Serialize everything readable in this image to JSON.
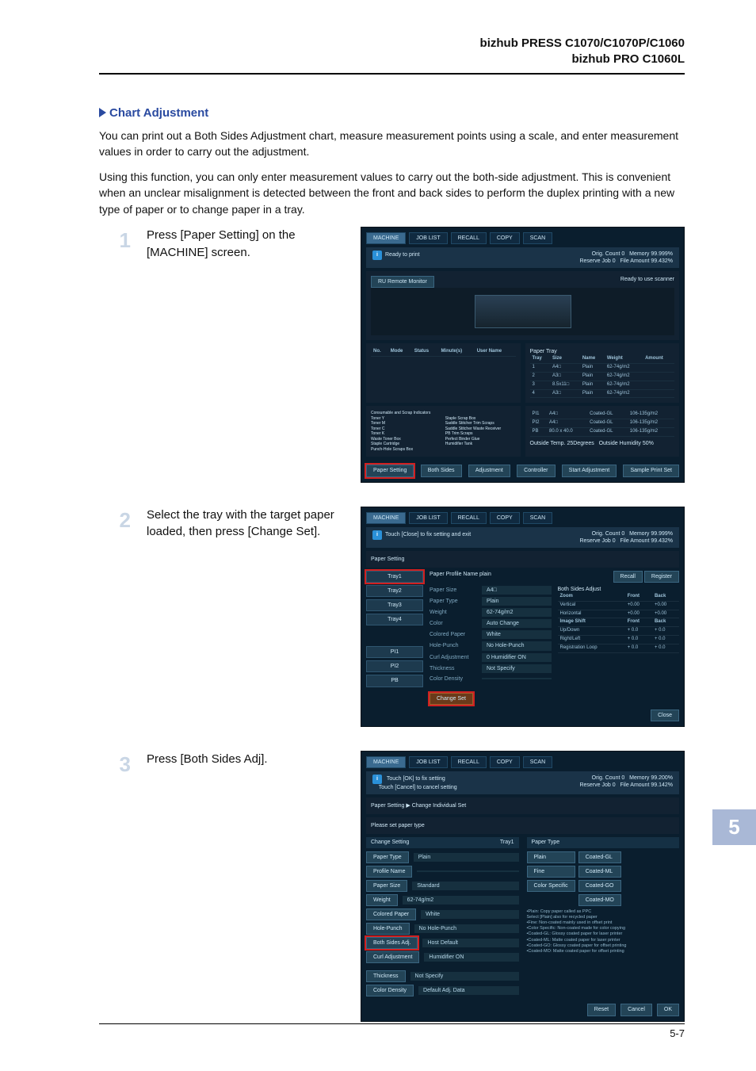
{
  "header": {
    "line1": "bizhub PRESS C1070/C1070P/C1060",
    "line2": "bizhub PRO C1060L"
  },
  "section_title": "Chart Adjustment",
  "paragraphs": {
    "p1": "You can print out a Both Sides Adjustment chart, measure measurement points using a scale, and enter measurement values in order to carry out the adjustment.",
    "p2": "Using this function, you can only enter measurement values to carry out the both-side adjustment. This is convenient when an unclear misalignment is detected between the front and back sides to perform the duplex printing with a new type of paper or to change paper in a tray."
  },
  "steps": {
    "s1": {
      "num": "1",
      "text": "Press [Paper Setting] on the [MACHINE] screen."
    },
    "s2": {
      "num": "2",
      "text": "Select the tray with the target paper loaded, then press [Change Set]."
    },
    "s3": {
      "num": "3",
      "text": "Press [Both Sides Adj]."
    }
  },
  "ss_common": {
    "machine_tab": "MACHINE",
    "joblist_tab": "JOB LIST",
    "recall_tab": "RECALL",
    "copy_tab": "COPY",
    "scan_tab": "SCAN",
    "orig_count": "Orig. Count",
    "reserve": "Reserve Job",
    "memory": "Memory",
    "file": "File Amount",
    "zero": "0",
    "m_pct": "99.999%",
    "f_pct": "99.432%",
    "ready_scanner": "Ready to use scanner"
  },
  "ss1": {
    "status": "Ready to print",
    "remote": "RU Remote Monitor",
    "paper_tray_hdr": "Paper Tray",
    "btn_paper_setting": "Paper Setting",
    "btn_both_sides": "Both Sides",
    "btn_adjustment": "Adjustment",
    "btn_controller": "Controller",
    "btn_start_adj": "Start Adjustment",
    "btn_sample": "Sample Print Set",
    "outside_temp": "Outside Temp.",
    "outside_temp_v": "25Degrees",
    "humidity": "Outside Humidity",
    "humidity_v": "50%",
    "consumable_hdr": "Consumable and Scrap Indicators",
    "trays": {
      "cols": [
        "Tray",
        "Size",
        "Name",
        "Weight",
        "Amount"
      ],
      "rows": [
        [
          "1",
          "A4□",
          "Plain",
          "62-74g/m2",
          ""
        ],
        [
          "2",
          "A3□",
          "Plain",
          "62-74g/m2",
          ""
        ],
        [
          "3",
          "8.5x11□",
          "Plain",
          "62-74g/m2",
          ""
        ],
        [
          "4",
          "A3□",
          "Plain",
          "62-74g/m2",
          ""
        ]
      ]
    },
    "pi_rows": [
      [
        "PI1",
        "A4□",
        "Coated-GL",
        "106-135g/m2"
      ],
      [
        "PI2",
        "A4□",
        "Coated-GL",
        "106-135g/m2"
      ],
      [
        "PB",
        "80.0 x 40.0",
        "Coated-GL",
        "106-135g/m2"
      ]
    ],
    "consumables": [
      "Toner Y",
      "Toner M",
      "Toner C",
      "Toner K",
      "Waste Toner Box",
      "Staple Cartridge",
      "Punch-Hole Scraps Box",
      "Staple Scrap Box",
      "Saddle Stitcher Trim Scraps",
      "Saddle Stitcher Waste Receiver",
      "PB Trim Scraps",
      "Perfect Binder Glue",
      "Humidifier Tank"
    ]
  },
  "ss2": {
    "status": "Touch [Close] to fix setting and exit",
    "breadcrumb": "Paper Setting",
    "tray_lbls": [
      "Tray1",
      "Tray2",
      "Tray3",
      "Tray4"
    ],
    "pi_lbls": [
      "PI1",
      "PI2",
      "PB"
    ],
    "btn_change": "Change Set",
    "btn_close": "Close",
    "btn_recall": "Recall",
    "btn_register": "Register",
    "profile": "Paper Profile Name",
    "profile_v": "plain",
    "both_sides_hdr": "Both Sides Adjust",
    "front": "Front",
    "back": "Back",
    "fields": [
      [
        "Paper Size",
        "A4□"
      ],
      [
        "Paper Type",
        "Plain"
      ],
      [
        "Weight",
        "62-74g/m2"
      ],
      [
        "Color",
        "Auto Change"
      ],
      [
        "Colored Paper",
        "White"
      ],
      [
        "Hole-Punch",
        "No Hole-Punch"
      ],
      [
        "Curl Adjustment",
        "0  Humidifier ON"
      ],
      [
        "Thickness",
        "Not Specify"
      ],
      [
        "Color Density",
        ""
      ]
    ],
    "bs_table": [
      [
        "Zoom",
        "Front",
        "Back"
      ],
      [
        "Vertical",
        "+0.00",
        "+0.00"
      ],
      [
        "Horizontal",
        "+0.00",
        "+0.00"
      ],
      [
        "Image Shift",
        "Front",
        "Back"
      ],
      [
        "Up/Down",
        "+ 0.0",
        "+ 0.0"
      ],
      [
        "Right/Left",
        "+ 0.0",
        "+ 0.0"
      ],
      [
        "Registration Loop",
        "+ 0.0",
        "+ 0.0"
      ]
    ]
  },
  "ss3": {
    "status1": "Touch [OK] to fix setting",
    "status2": "Touch [Cancel] to cancel setting",
    "breadcrumb": "Paper Setting    ▶  Change Individual Set",
    "instr": "Please set paper type",
    "change_hdr": "Change Setting",
    "paper_type_hdr": "Paper Type",
    "col_cat": "Tray1",
    "left_items": [
      [
        "Paper Type",
        "Plain"
      ],
      [
        "Profile Name",
        ""
      ],
      [
        "Paper Size",
        "Standard"
      ],
      [
        "Weight",
        "62-74g/m2"
      ],
      [
        "Colored Paper",
        "White"
      ],
      [
        "Hole-Punch",
        "No Hole-Punch"
      ],
      [
        "Both Sides Adj.",
        "Host Default"
      ],
      [
        "Curl Adjustment",
        "Humidifier ON"
      ]
    ],
    "thickness_row": [
      "Thickness",
      "Not Specify"
    ],
    "density_row": [
      "Color Density",
      "Default Adj. Data"
    ],
    "type_btns": [
      "Plain",
      "Fine",
      "Color Specific"
    ],
    "coat_btns": [
      "Coated-GL",
      "Coated-ML",
      "Coated-GO",
      "Coated-MO"
    ],
    "notes": [
      "•Plain: Copy paper called as PPC",
      "  Select [Plain] also for recycled paper",
      "•Fine: Non-coated mainly used in offset print",
      "•Color Specific: Non-coated made for color copying",
      "•Coated-GL: Glossy coated paper for laser printer",
      "•Coated-ML: Matte coated paper for laser printer",
      "•Coated-GO: Glossy coated paper for offset printing",
      "•Coated-MO: Matte coated paper for offset printing"
    ],
    "btn_reset": "Reset",
    "btn_cancel": "Cancel",
    "btn_ok": "OK"
  },
  "footer": {
    "chapter": "5",
    "page": "5-7"
  }
}
